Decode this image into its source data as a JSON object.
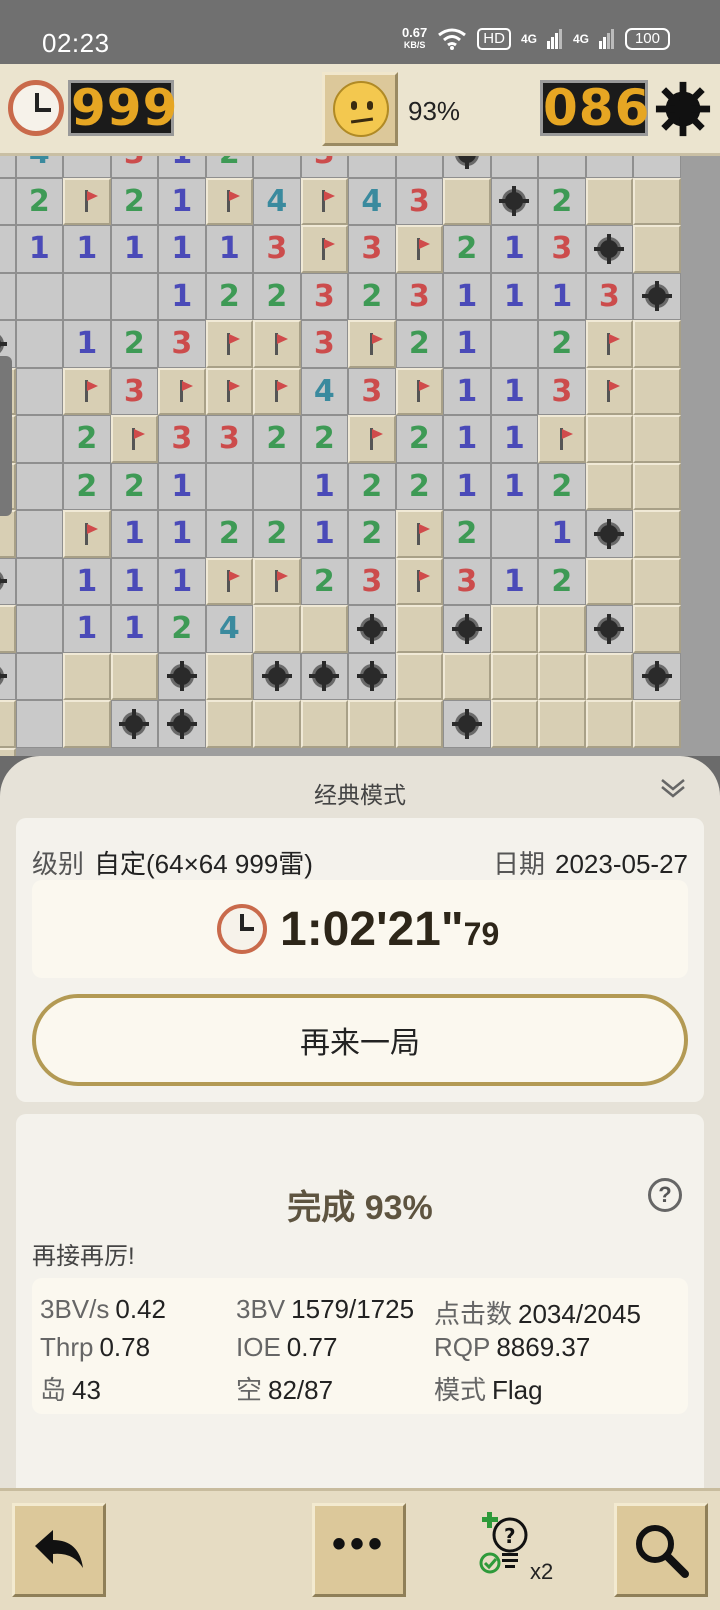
{
  "status_bar": {
    "time": "02:23",
    "net_speed": "0.67",
    "net_unit": "KB/S",
    "hd": "HD",
    "signal1": "4G",
    "signal2": "4G",
    "battery": "100"
  },
  "game_bar": {
    "timer": "999",
    "progress": "93%",
    "mines_left": "086"
  },
  "board": {
    "rows": [
      "4 . 3 1 2 . 3 . . * . . . .",
      "2 F 2 1 F 4 F 4 3 # * 2 # #",
      "1 1 1 1 1 3 F 3 F 2 1 3 * #",
      "  . 1 2 2 3 2 3 1 1 1 3 * *",
      "1 2 3 F F 3 F 2 1 . 2 F # #",
      "F 3 F F F 4 3 F 1 1 3 F # #",
      "2 F 3 3 2 2 F 2 1 1 F # # #",
      "2 2 1 . . 1 2 2 1 1 2 # # #",
      "F 1 1 2 2 1 2 F 2 . 1 * # *",
      "1 1 1 F F 2 3 F 3 1 2 # # #",
      "1 1 2 4 # # * # * # # * # *",
      "# # * # * * * # # # # # * #",
      "# * * # # # # # * # # # # #"
    ]
  },
  "sheet": {
    "title": "经典模式",
    "level_label": "级别",
    "level_value": "自定(64×64  999雷)",
    "date_label": "日期",
    "date_value": "2023-05-27",
    "time_main": "1:02'21\"",
    "time_cs": "79",
    "again_label": "再来一局",
    "done_label": "完成 93%",
    "help_glyph": "?",
    "cheer": "再接再厉!",
    "stats": {
      "bvs_k": "3BV/s",
      "bvs_v": "0.42",
      "bv_k": "3BV",
      "bv_v": "1579/1725",
      "clicks_k": "点击数",
      "clicks_v": "2034/2045",
      "thrp_k": "Thrp",
      "thrp_v": "0.78",
      "ioe_k": "IOE",
      "ioe_v": "0.77",
      "rqp_k": "RQP",
      "rqp_v": "8869.37",
      "island_k": "岛",
      "island_v": "43",
      "empty_k": "空",
      "empty_v": "82/87",
      "mode_k": "模式",
      "mode_v": "Flag"
    }
  },
  "toolbar": {
    "more_glyph": "•••",
    "hint_count": "x2"
  },
  "icons": {
    "clock": "clock-icon",
    "face": "sad-face-icon",
    "gear": "mine-settings-icon",
    "back": "undo-arrow-icon",
    "hint": "lightbulb-hint-icon",
    "search": "magnifier-icon"
  }
}
